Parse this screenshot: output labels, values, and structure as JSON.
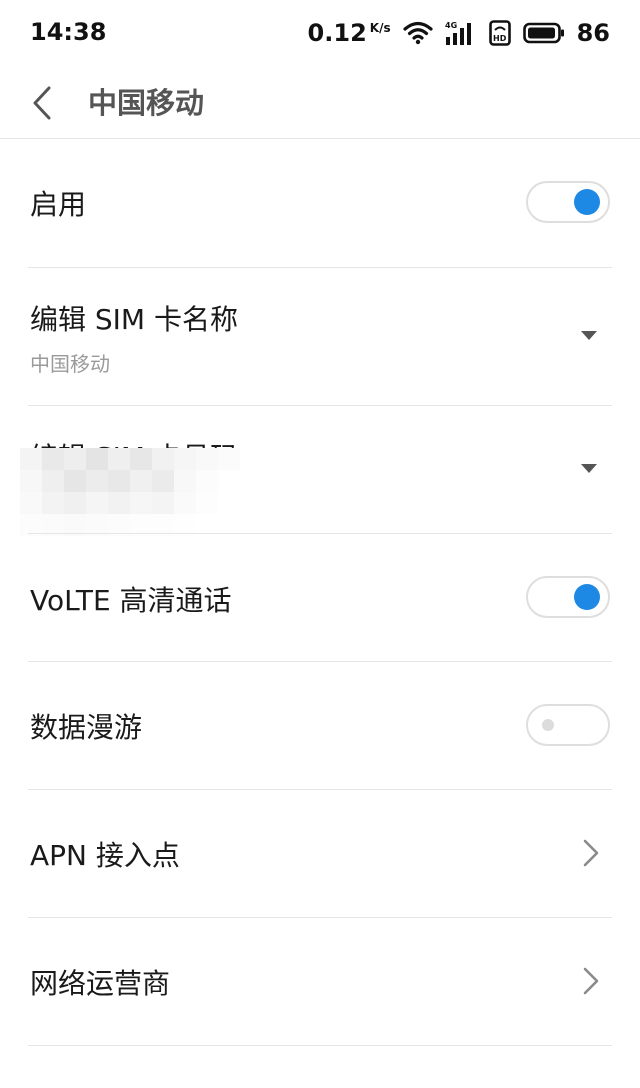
{
  "status_bar": {
    "time": "14:38",
    "net_speed": "0.12",
    "net_unit": "K/s",
    "battery_level": "86",
    "icons": [
      "wifi-icon",
      "signal-4g-icon",
      "hd-icon",
      "battery-icon"
    ]
  },
  "header": {
    "title": "中国移动",
    "back_icon": "back-arrow-icon"
  },
  "settings": {
    "enable": {
      "label": "启用",
      "state": true
    },
    "sim_name": {
      "label": "编辑 SIM 卡名称",
      "value": "中国移动"
    },
    "sim_number": {
      "label": "编辑 SIM 卡号码"
    },
    "volte": {
      "label": "VoLTE 高清通话",
      "state": true
    },
    "roaming": {
      "label": "数据漫游",
      "state": false
    },
    "apn": {
      "label": "APN 接入点"
    },
    "operator": {
      "label": "网络运营商"
    }
  },
  "colors": {
    "accent": "#1e88e5",
    "divider": "#e6e6e6",
    "secondary_text": "#9a9a9a"
  }
}
